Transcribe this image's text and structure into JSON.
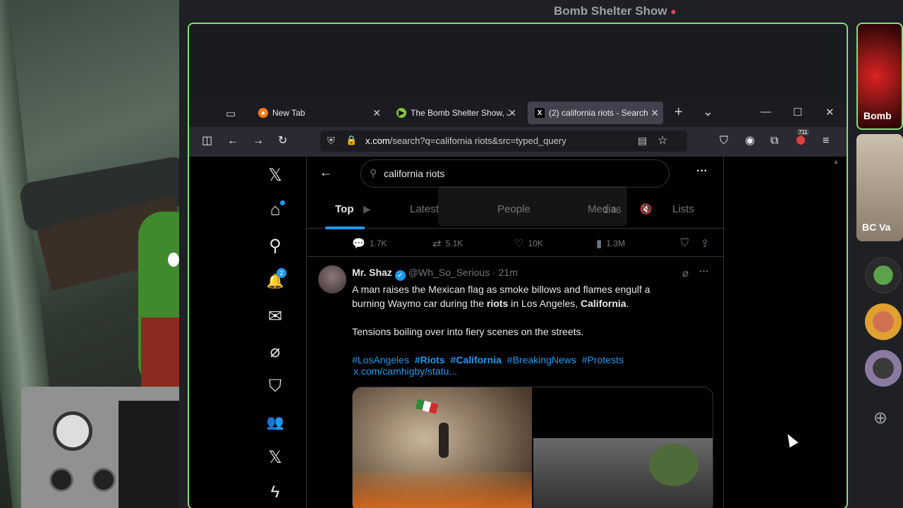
{
  "stream": {
    "title": "Bomb Shelter Show",
    "live_dot": "●"
  },
  "browser": {
    "tabs": [
      {
        "label": "New Tab",
        "icon": "firefox-icon",
        "close": "✕"
      },
      {
        "label": "The Bomb Shelter Show, J",
        "icon": "rumble-play-icon",
        "close": "✕"
      },
      {
        "label": "(2) california riots - Search",
        "icon": "x-logo-icon",
        "close": "✕",
        "active": true
      }
    ],
    "new_tab": "+",
    "tab_list": "⌄",
    "window_controls": {
      "minimize": "—",
      "maximize": "☐",
      "close": "✕"
    },
    "url": {
      "host": "x.com",
      "path": "/search?q=california riots&src=typed_query"
    },
    "extension_badge": "711"
  },
  "sidenav": {
    "items": [
      {
        "name": "x-logo-icon",
        "glyph": "𝕏"
      },
      {
        "name": "home-icon",
        "glyph": "⌂"
      },
      {
        "name": "explore-icon",
        "glyph": "⚲"
      },
      {
        "name": "notifications-icon",
        "glyph": "🔔",
        "badge": "2"
      },
      {
        "name": "messages-icon",
        "glyph": "✉"
      },
      {
        "name": "grok-icon",
        "glyph": "⌀"
      },
      {
        "name": "bookmarks-icon",
        "glyph": "⛉"
      },
      {
        "name": "communities-icon",
        "glyph": "👥"
      },
      {
        "name": "premium-icon",
        "glyph": "𝕏"
      },
      {
        "name": "verified-orgs-icon",
        "glyph": "ϟ"
      }
    ]
  },
  "search": {
    "query": "california riots",
    "back": "←",
    "more": "···"
  },
  "feed_tabs": {
    "top": "Top",
    "latest": "Latest",
    "people": "People",
    "media": "Media",
    "lists": "Lists"
  },
  "overlay": {
    "time": "1:46"
  },
  "stats": {
    "replies": "1.7K",
    "reposts": "5.1K",
    "likes": "10K",
    "views": "1.3M"
  },
  "tweet": {
    "name": "Mr. Shaz",
    "verified": "✓",
    "handle": "@Wh_So_Serious · 21m",
    "text_1a": "A man raises the Mexican flag as smoke billows and flames engulf a",
    "text_1b_pre": "burning Waymo car during the ",
    "text_1b_bold1": "riots",
    "text_1b_mid": " in Los Angeles, ",
    "text_1b_bold2": "California",
    "text_1b_end": ".",
    "text_2": "Tensions boiling over into fiery scenes on the streets.",
    "hashtags": [
      "#LosAngeles",
      "#Riots",
      "#California",
      "#BreakingNews",
      "#Protests"
    ],
    "link": "x.com/camhigby/statu..."
  },
  "participants": [
    {
      "label": "Bomb"
    },
    {
      "label": "BC Va"
    }
  ],
  "colors": {
    "accent": "#1d9bf0",
    "frame": "#7fe27a",
    "live": "#e0455a"
  }
}
